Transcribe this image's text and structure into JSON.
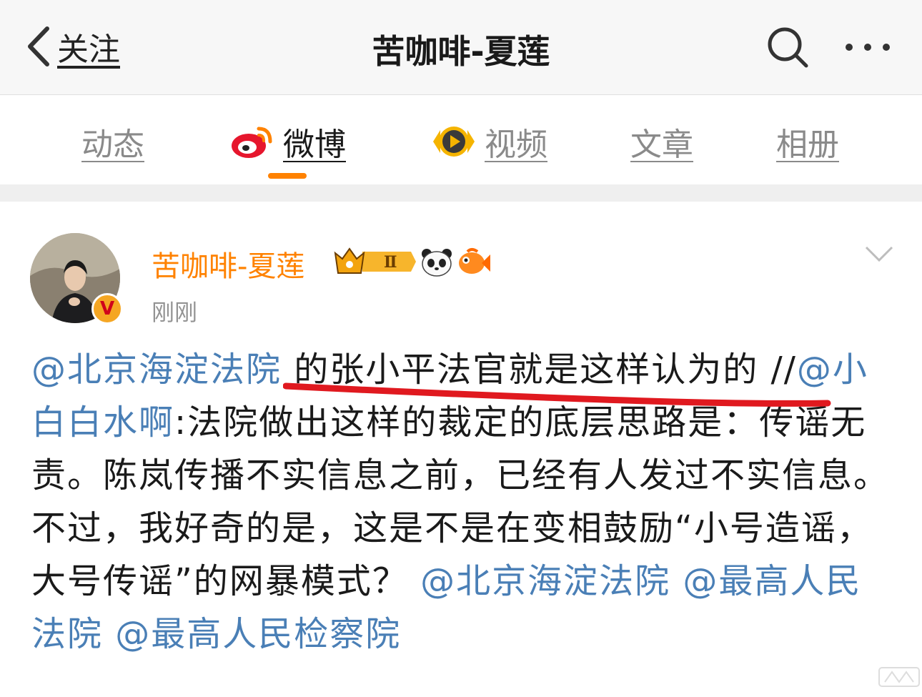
{
  "nav": {
    "back_label": "关注",
    "title": "苦咖啡-夏莲"
  },
  "tabs": [
    {
      "label": "动态",
      "icon": null,
      "active": false
    },
    {
      "label": "微博",
      "icon": "weibo-logo-icon",
      "active": true
    },
    {
      "label": "视频",
      "icon": "video-play-icon",
      "active": false
    },
    {
      "label": "文章",
      "icon": null,
      "active": false
    },
    {
      "label": "相册",
      "icon": null,
      "active": false
    }
  ],
  "post": {
    "author": "苦咖啡-夏莲",
    "vip_level": "Ⅱ",
    "verify_mark": "V",
    "time": "刚刚",
    "body": {
      "mention1": "@北京海淀法院",
      "text1": " 的张小平法官就是这样认为的 ",
      "separator": "//",
      "mention2": "@小白白水啊",
      "text2": ":法院做出这样的裁定的底层思路是：传谣无责。陈岚传播不实信息之前，已经有人发过不实信息。 不过，我好奇的是，这是不是在变相鼓励“小号造谣，大号传谣”的网暴模式？",
      "mention3": "@北京海淀法院",
      "mention4": "@最高人民法院",
      "mention5": "@最高人民检察院"
    }
  },
  "colors": {
    "accent": "#ff8200",
    "mention": "#4a7fb6",
    "annotation_red": "#e0191f"
  }
}
